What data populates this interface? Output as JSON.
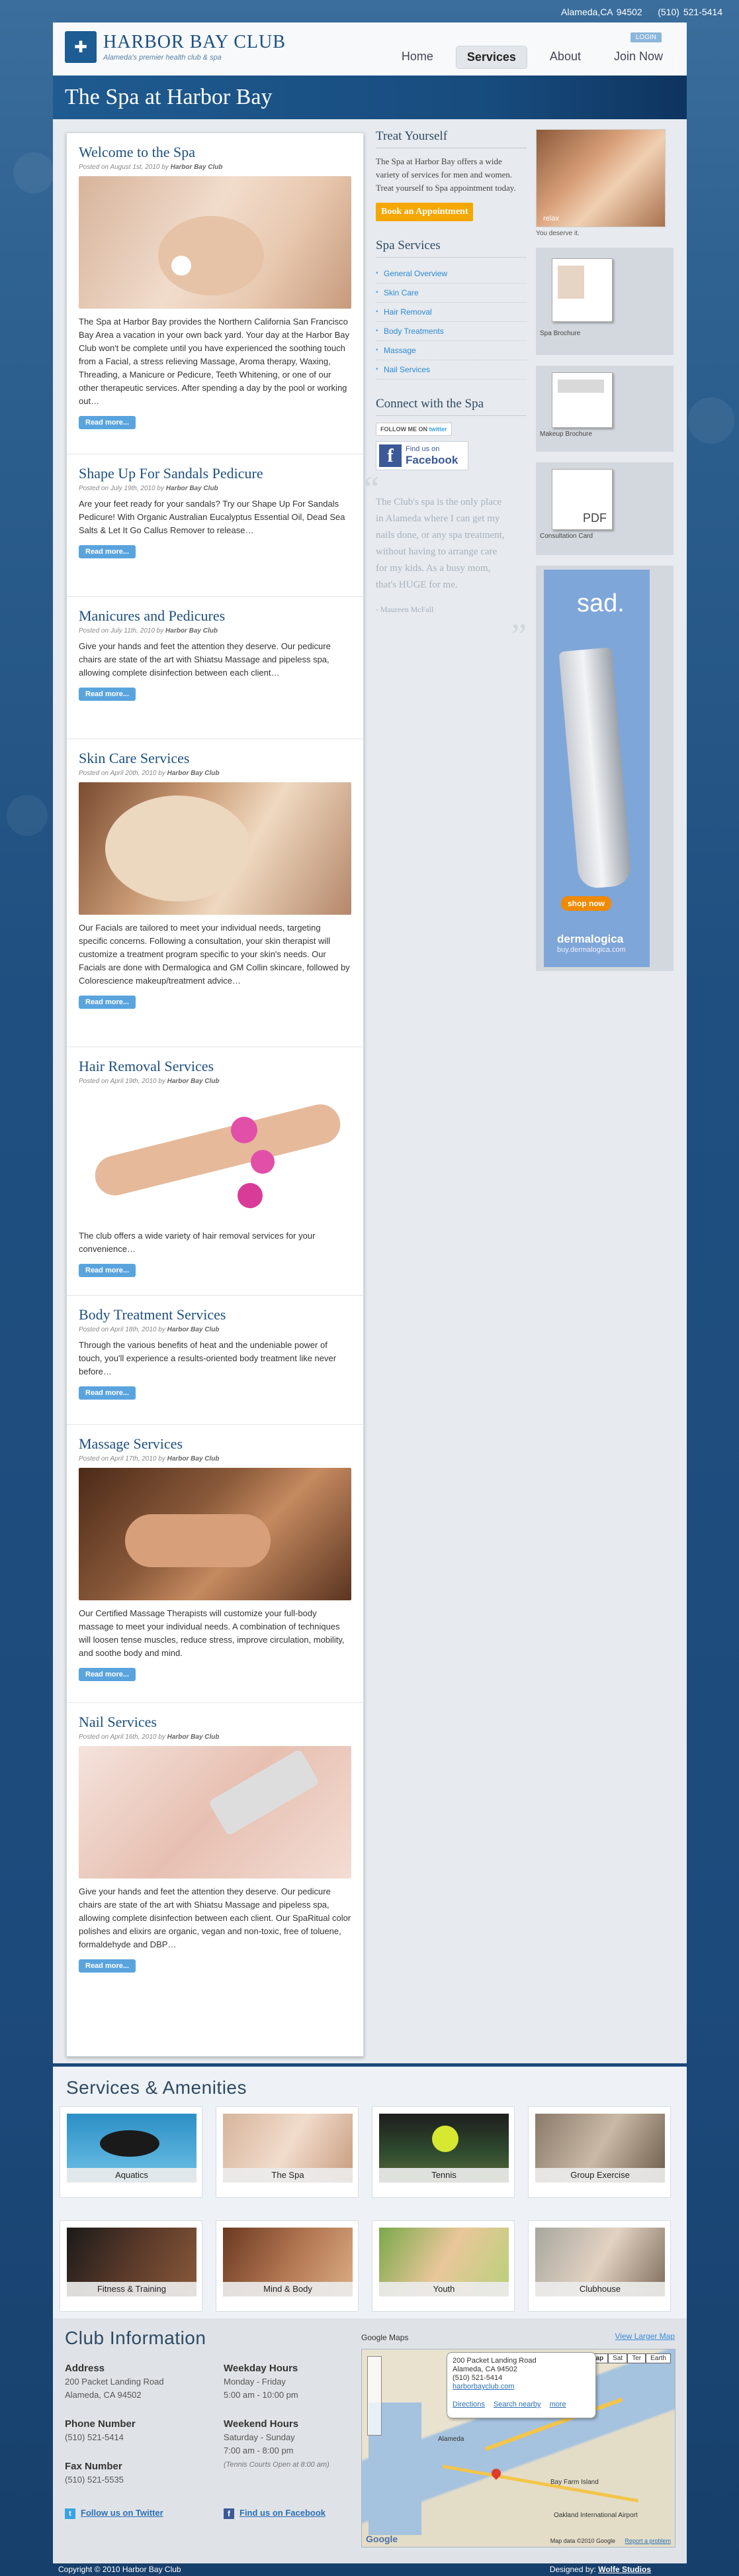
{
  "topbar": {
    "location": "Alameda,CA 94502",
    "phone": "(510) 521-5414"
  },
  "header": {
    "name": "HARBOR BAY CLUB",
    "tagline": "Alameda's premier health club & spa",
    "login": "LOGIN",
    "nav": [
      "Home",
      "Services",
      "About",
      "Join Now"
    ]
  },
  "page_title": "The Spa at Harbor Bay",
  "posts": [
    {
      "title": "Welcome to the Spa",
      "date": "Posted on August 1st, 2010 by",
      "author": "Harbor Bay Club",
      "body": "The Spa at Harbor Bay provides the Northern California San Francisco Bay Area a vacation in your own back yard. Your day at the Harbor Bay Club won't be complete until you have experienced the soothing touch from a Facial, a stress relieving Massage, Aroma therapy, Waxing, Threading, a Manicure or Pedicure, Teeth Whitening, or one of our other therapeutic services. After spending a day by the pool or working out…",
      "more": "Read more..."
    },
    {
      "title": "Shape Up For Sandals Pedicure",
      "date": "Posted on July 19th, 2010 by",
      "author": "Harbor Bay Club",
      "body": "Are your feet ready for your sandals? Try our Shape Up For Sandals Pedicure! With Organic Australian Eucalyptus Essential Oil, Dead Sea Salts & Let It Go Callus Remover to release…",
      "more": "Read more..."
    },
    {
      "title": "Manicures and Pedicures",
      "date": "Posted on July 11th, 2010 by",
      "author": "Harbor Bay Club",
      "body": "Give your hands and feet the attention they deserve. Our pedicure chairs are state of the art with Shiatsu Massage and pipeless spa, allowing complete disinfection between each client…",
      "more": "Read more..."
    },
    {
      "title": "Skin Care Services",
      "date": "Posted on April 20th, 2010 by",
      "author": "Harbor Bay Club",
      "body": "Our Facials are tailored to meet your individual needs, targeting specific concerns. Following a consultation, your skin therapist will customize a treatment program specific to your skin's needs. Our Facials are done with Dermalogica and GM Collin skincare, followed by Colorescience makeup/treatment advice…",
      "more": "Read more..."
    },
    {
      "title": "Hair Removal Services",
      "date": "Posted on April 19th, 2010 by",
      "author": "Harbor Bay Club",
      "body": "The club offers a wide variety of hair removal services for your convenience…",
      "more": "Read more..."
    },
    {
      "title": "Body Treatment Services",
      "date": "Posted on April 18th, 2010 by",
      "author": "Harbor Bay Club",
      "body": "Through the various benefits of heat and the undeniable power of touch, you'll experience a results-oriented body treatment like never before…",
      "more": "Read more..."
    },
    {
      "title": "Massage Services",
      "date": "Posted on April 17th, 2010 by",
      "author": "Harbor Bay Club",
      "body": "Our Certified Massage Therapists will customize your full-body massage to meet your individual needs. A combination of techniques will loosen tense muscles, reduce stress, improve circulation, mobility, and soothe body and mind.",
      "more": "Read more..."
    },
    {
      "title": "Nail Services",
      "date": "Posted on April 16th, 2010 by",
      "author": "Harbor Bay Club",
      "body": "Give your hands and feet the attention they deserve. Our pedicure chairs are state of the art with Shiatsu Massage and pipeless spa, allowing complete disinfection between each client. Our SpaRitual color polishes and elixirs are organic, vegan and non-toxic, free of toluene, formaldehyde and DBP…",
      "more": "Read more..."
    }
  ],
  "sidebar": {
    "treat_title": "Treat Yourself",
    "treat_desc": "The Spa at Harbor Bay offers a wide variety of services for men and women. Treat yourself to Spa appointment today.",
    "book": "Book an Appointment",
    "services_title": "Spa Services",
    "services": [
      "General Overview",
      "Skin Care",
      "Hair Removal",
      "Body Treatments",
      "Massage",
      "Nail Services"
    ],
    "connect_title": "Connect with the Spa",
    "follow": "FOLLOW ME ON",
    "twitter": "twitter",
    "fb_find": "Find us on",
    "fb_name": "Facebook",
    "quote": "The Club's spa is the only place in Alameda where I can get my nails done, or any spa treatment, without having to arrange care for my kids. As a busy mom, that's HUGE for me.",
    "quote_author": "- Maureen McFall"
  },
  "right": {
    "relax": "relax",
    "deserve": "You deserve it.",
    "docs": [
      "Spa Brochure",
      "Makeup Brochure",
      "Consultation Card"
    ],
    "pdf": "PDF",
    "ad_head": "sad.",
    "ad_shop": "shop now",
    "ad_brand": "dermalogica",
    "ad_url": "buy.dermalogica.com"
  },
  "amenities": {
    "title": "Services & Amenities",
    "items": [
      "Aquatics",
      "The Spa",
      "Tennis",
      "Group Exercise",
      "Fitness & Training",
      "Mind & Body",
      "Youth",
      "Clubhouse"
    ]
  },
  "club": {
    "title": "Club Information",
    "address_h": "Address",
    "address1": "200 Packet Landing Road",
    "address2": "Alameda, CA 94502",
    "phone_h": "Phone Number",
    "phone": "(510) 521-5414",
    "fax_h": "Fax Number",
    "fax": "(510) 521-5535",
    "wk_h": "Weekday Hours",
    "wk1": "Monday - Friday",
    "wk2": "5:00 am - 10:00 pm",
    "we_h": "Weekend Hours",
    "we1": "Saturday - Sunday",
    "we2": "7:00 am - 8:00 pm",
    "we3": "(Tennis Courts Open at 8:00 am)",
    "twitter": "Follow us on Twitter",
    "facebook": "Find us on Facebook",
    "gm": "Google Maps",
    "larger": "View Larger Map",
    "map_addr1": "200 Packet Landing Road",
    "map_addr2": "Alameda, CA 94502",
    "map_phone": "(510) 521-5414",
    "map_site": "harborbayclub.com",
    "map_links": [
      "Directions",
      "Search nearby",
      "more"
    ],
    "map_types": [
      "Map",
      "Sat",
      "Ter",
      "Earth"
    ],
    "map_labels": [
      "Alameda",
      "Bay Farm Island",
      "Oakland International Airport"
    ],
    "map_footer": "Map data ©2010 Google",
    "map_report": "Report a problem",
    "map_brand": "Google"
  },
  "footer": {
    "copy": "Copyright © 2010 Harbor Bay Club",
    "designed": "Designed by:",
    "studio": "Wolfe Studios"
  }
}
